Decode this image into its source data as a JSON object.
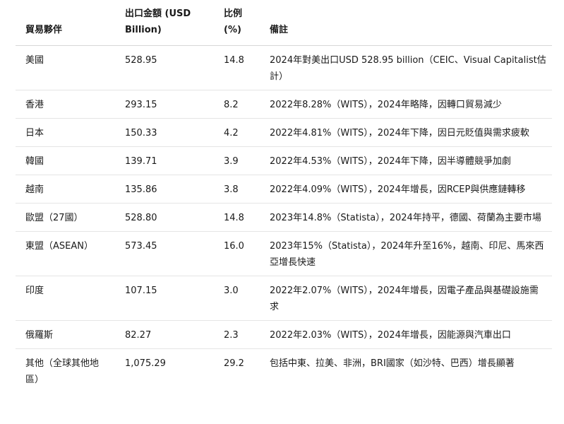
{
  "headers": {
    "partner": "貿易夥伴",
    "amount": "出口金額 (USD Billion)",
    "share": "比例 (%)",
    "note": "備註"
  },
  "rows": [
    {
      "partner": "美國",
      "amount": "528.95",
      "share": "14.8",
      "note": "2024年對美出口USD 528.95 billion（CEIC、Visual Capitalist估計）"
    },
    {
      "partner": "香港",
      "amount": "293.15",
      "share": "8.2",
      "note": "2022年8.28%（WITS），2024年略降，因轉口貿易減少"
    },
    {
      "partner": "日本",
      "amount": "150.33",
      "share": "4.2",
      "note": "2022年4.81%（WITS），2024年下降，因日元貶值與需求疲軟"
    },
    {
      "partner": "韓國",
      "amount": "139.71",
      "share": "3.9",
      "note": "2022年4.53%（WITS），2024年下降，因半導體競爭加劇"
    },
    {
      "partner": "越南",
      "amount": "135.86",
      "share": "3.8",
      "note": "2022年4.09%（WITS），2024年增長，因RCEP與供應鏈轉移"
    },
    {
      "partner": "歐盟（27國）",
      "amount": "528.80",
      "share": "14.8",
      "note": "2023年14.8%（Statista），2024年持平，德國、荷蘭為主要市場"
    },
    {
      "partner": "東盟（ASEAN）",
      "amount": "573.45",
      "share": "16.0",
      "note": "2023年15%（Statista），2024年升至16%，越南、印尼、馬來西亞增長快速"
    },
    {
      "partner": "印度",
      "amount": "107.15",
      "share": "3.0",
      "note": "2022年2.07%（WITS），2024年增長，因電子產品與基礎設施需求"
    },
    {
      "partner": "俄羅斯",
      "amount": "82.27",
      "share": "2.3",
      "note": "2022年2.03%（WITS），2024年增長，因能源與汽車出口"
    },
    {
      "partner": "其他（全球其他地區）",
      "amount": "1,075.29",
      "share": "29.2",
      "note": "包括中東、拉美、非洲，BRI國家（如沙特、巴西）增長顯著"
    }
  ]
}
